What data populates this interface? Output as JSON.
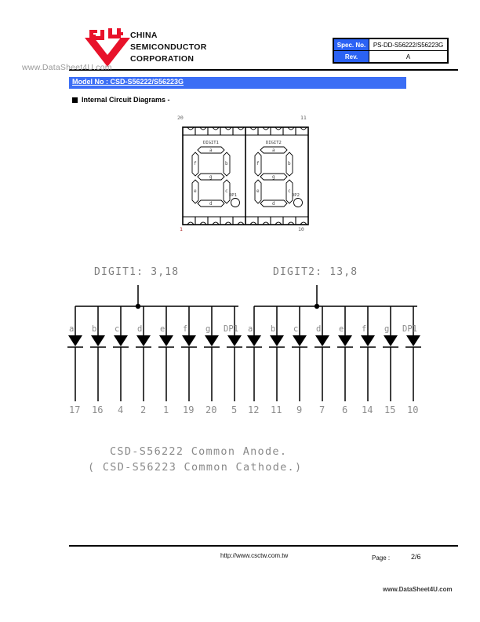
{
  "document": {
    "watermark_top": "www.DataSheet4U.com",
    "watermark_bottom": "www.DataSheet4U.com"
  },
  "header": {
    "logo_name": "china-semiconductor-logo",
    "company_line1": "CHINA",
    "company_line2": "SEMICONDUCTOR",
    "company_line3": "CORPORATION",
    "spec_table": {
      "rows": [
        {
          "label": "Spec. No.",
          "value": "PS-DD-S56222/S56223G"
        },
        {
          "label": "Rev.",
          "value": "A"
        }
      ]
    },
    "label_color": "#2b62f4"
  },
  "model": {
    "bar_color": "#3b6ef5",
    "text": "Model No : CSD-S56222/S56223G"
  },
  "section": {
    "title": "Internal Circuit Diagrams -"
  },
  "package": {
    "pins": {
      "top_left": "20",
      "top_right": "11",
      "bottom_left": "1",
      "bottom_right": "10"
    },
    "digits": [
      {
        "name": "DIGIT1",
        "segments": [
          "a",
          "b",
          "c",
          "d",
          "e",
          "f",
          "g"
        ],
        "decimal_point": "DP1"
      },
      {
        "name": "DIGIT2",
        "segments": [
          "a",
          "b",
          "c",
          "d",
          "e",
          "f",
          "g"
        ],
        "decimal_point": "DP2"
      }
    ]
  },
  "schematic": {
    "groups": [
      {
        "title": "DIGIT1: 3,18",
        "segment_labels": [
          "a",
          "b",
          "c",
          "d",
          "e",
          "f",
          "g",
          "DP1"
        ],
        "pin_numbers": [
          "17",
          "16",
          "4",
          "2",
          "1",
          "19",
          "20",
          "5"
        ]
      },
      {
        "title": "DIGIT2: 13,8",
        "segment_labels": [
          "a",
          "b",
          "c",
          "d",
          "e",
          "f",
          "g",
          "DP1"
        ],
        "pin_numbers": [
          "12",
          "11",
          "9",
          "7",
          "6",
          "14",
          "15",
          "10"
        ]
      }
    ],
    "caption_line1": "CSD-S56222 Common Anode.",
    "caption_line2": "( CSD-S56223 Common Cathode.)"
  },
  "footer": {
    "url": "http://www.csctw.com.tw",
    "page_label": "Page :",
    "page_value": "2/6"
  }
}
